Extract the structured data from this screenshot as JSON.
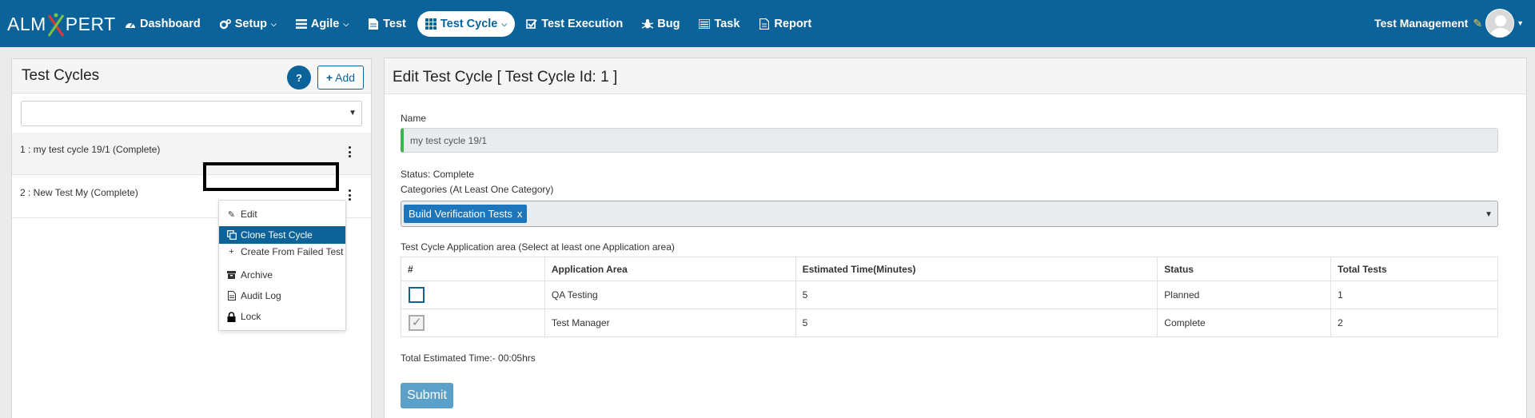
{
  "app": {
    "logo_left": "ALM",
    "logo_right": "PERT",
    "logo_x": "X"
  },
  "nav": {
    "items": [
      {
        "label": "Dashboard",
        "icon": "dashboard-icon",
        "caret": false,
        "active": false
      },
      {
        "label": "Setup",
        "icon": "cogs-icon",
        "caret": true,
        "active": false
      },
      {
        "label": "Agile",
        "icon": "list-icon",
        "caret": true,
        "active": false
      },
      {
        "label": "Test",
        "icon": "file-icon",
        "caret": false,
        "active": false
      },
      {
        "label": "Test Cycle",
        "icon": "grid-icon",
        "caret": true,
        "active": true
      },
      {
        "label": "Test Execution",
        "icon": "check-square-icon",
        "caret": false,
        "active": false
      },
      {
        "label": "Bug",
        "icon": "bug-icon",
        "caret": false,
        "active": false
      },
      {
        "label": "Task",
        "icon": "tasks-icon",
        "caret": false,
        "active": false
      },
      {
        "label": "Report",
        "icon": "report-icon",
        "caret": false,
        "active": false
      }
    ],
    "user_label": "Test Management"
  },
  "left_panel": {
    "title": "Test Cycles",
    "help_label": "?",
    "add_label": "Add",
    "filter_value": "",
    "cycles": [
      {
        "label": "1 : my test cycle 19/1 (Complete)"
      },
      {
        "label": "2 : New Test My (Complete)"
      }
    ],
    "menu": {
      "edit": "Edit",
      "clone": "Clone Test Cycle",
      "create_failed": "Create From Failed Test",
      "archive": "Archive",
      "audit": "Audit Log",
      "lock": "Lock"
    }
  },
  "form": {
    "title": "Edit Test Cycle  [ Test Cycle Id: 1 ]",
    "name_label": "Name",
    "name_value": "my test cycle 19/1",
    "status_text": "Status: Complete",
    "categories_label": "Categories (At Least One Category)",
    "categories": [
      "Build Verification Tests"
    ],
    "category_remove": "x",
    "app_area_label": "Test Cycle Application area (Select at least one Application area)",
    "table": {
      "headers": [
        "#",
        "Application Area",
        "Estimated Time(Minutes)",
        "Status",
        "Total Tests"
      ],
      "rows": [
        {
          "checked": false,
          "area": "QA Testing",
          "time": "5",
          "status": "Planned",
          "total": "1"
        },
        {
          "checked": true,
          "area": "Test Manager",
          "time": "5",
          "status": "Complete",
          "total": "2"
        }
      ]
    },
    "total_time": "Total Estimated Time:- 00:05hrs",
    "submit_label": "Submit"
  },
  "colors": {
    "brand": "#0b6399",
    "accent_green": "#3fb34f",
    "tag_blue": "#1d75bc"
  }
}
